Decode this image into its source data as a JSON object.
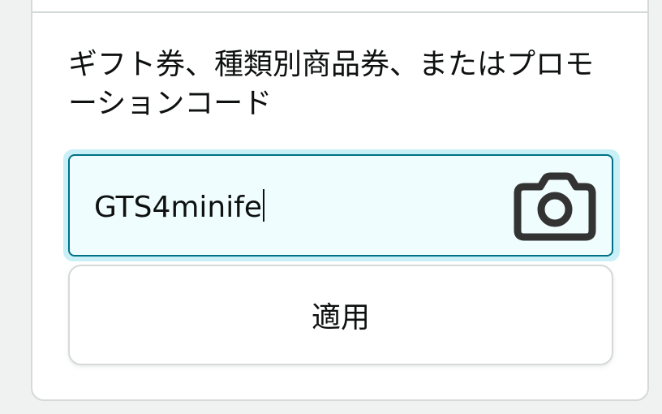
{
  "section": {
    "label": "ギフト券、種類別商品券、またはプロモーションコード"
  },
  "code_input": {
    "value": "GTS4minife"
  },
  "camera_button": {
    "icon": "camera-icon"
  },
  "apply_button": {
    "label": "適用"
  },
  "colors": {
    "focus_border": "#007185",
    "focus_ring": "#c9f0f6",
    "input_bg": "#f0fdfe",
    "text": "#0f1111",
    "border": "#d5d9d9"
  }
}
